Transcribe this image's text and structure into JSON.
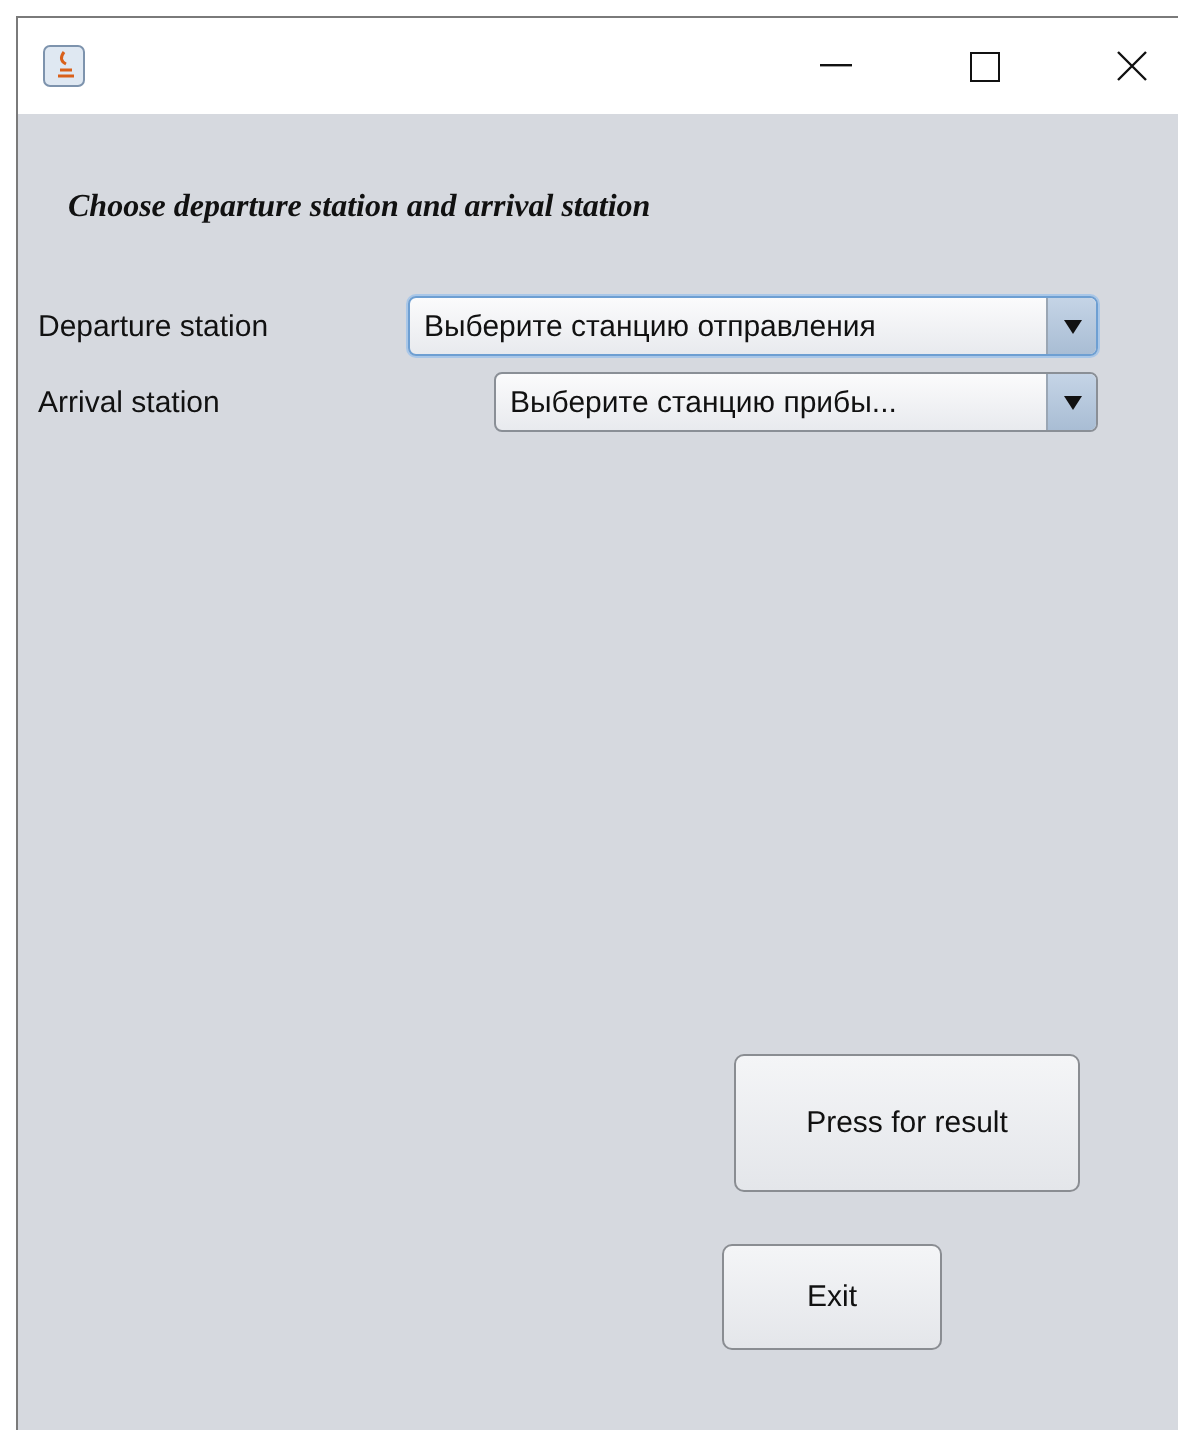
{
  "heading": "Choose departure station and arrival station",
  "fields": [
    {
      "label": "Departure station",
      "value": "Выберите станцию отправления",
      "focused": true
    },
    {
      "label": "Arrival station",
      "value": "Выберите станцию прибы...",
      "focused": false
    }
  ],
  "buttons": [
    {
      "label": "Press for result",
      "kind": "large"
    },
    {
      "label": "Exit",
      "kind": "small"
    }
  ]
}
